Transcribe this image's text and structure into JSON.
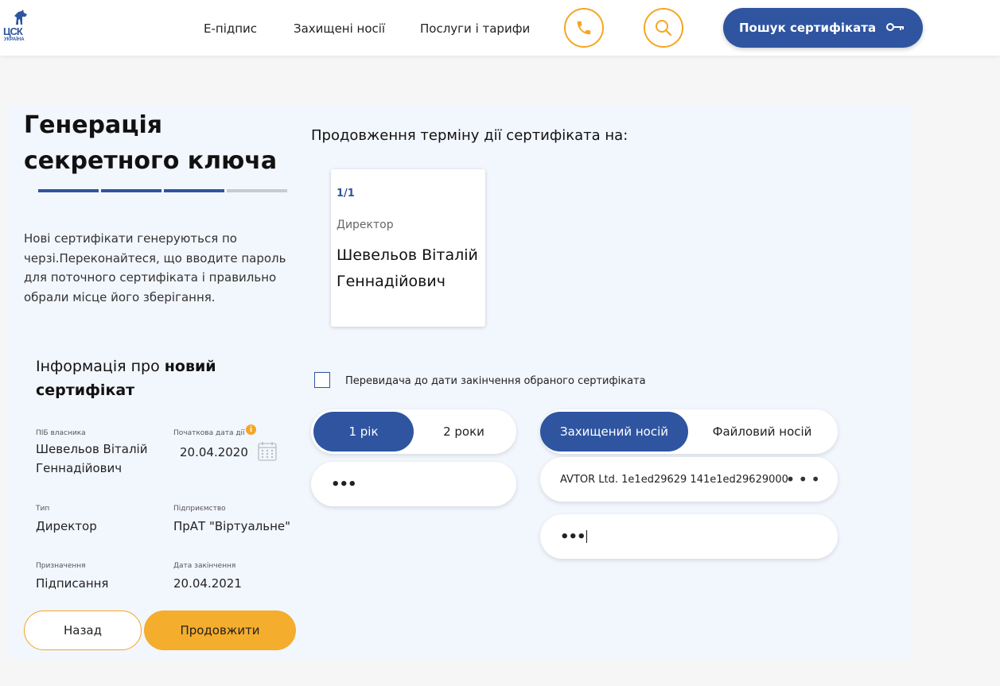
{
  "header": {
    "logo_main": "ЦСК",
    "logo_sub": "УКРАЇНА",
    "nav": [
      "Е-підпис",
      "Захищені носії",
      "Послуги і тарифи"
    ],
    "search_cert_label": "Пошук сертифіката",
    "icons": [
      "phone-icon",
      "search-icon",
      "key-icon"
    ]
  },
  "left": {
    "title": "Генерація секретного ключа",
    "progress_steps": 4,
    "progress_done": 3,
    "intro": "Нові сертифікати генеруються по черзі.Переконайтеся, що вводите пароль для поточного сертифіката і правильно обрали місце його зберігання.",
    "info_heading_prefix": "Інформація про ",
    "info_heading_bold": "новий сертифікат",
    "fields": {
      "owner_label": "ПІБ власника",
      "owner_value": "Шевельов Віталій Геннадійович",
      "start_label": "Початкова дата дії",
      "start_value": "20.04.2020",
      "type_label": "Тип",
      "type_value": "Директор",
      "org_label": "Підприємство",
      "org_value": "ПрАТ \"Віртуальне\"",
      "purpose_label": "Призначення",
      "purpose_value": "Підписання",
      "end_label": "Дата закінчення",
      "end_value": "20.04.2021"
    },
    "info_icon": "i",
    "back_label": "Назад",
    "next_label": "Продовжити"
  },
  "right": {
    "extend_heading": "Продовження терміну дії сертифіката на:",
    "card": {
      "counter": "1/1",
      "role": "Директор",
      "name": "Шевельов Віталій Геннадійович"
    },
    "checkbox_label": "Перевидача до дати закінчення обраного сертифіката",
    "term_options": [
      "1 рік",
      "2 роки"
    ],
    "term_selected": 0,
    "password_mask": "•••",
    "media_options": [
      "Захищений носій",
      "Файловий носій"
    ],
    "media_selected": 0,
    "device_name": "AVTOR Ltd. 1e1ed29629 141e1ed29629000",
    "media_password_mask": "•••"
  },
  "colors": {
    "primary": "#2f55a0",
    "accent": "#f5a623",
    "panel": "#f2f6fd"
  }
}
